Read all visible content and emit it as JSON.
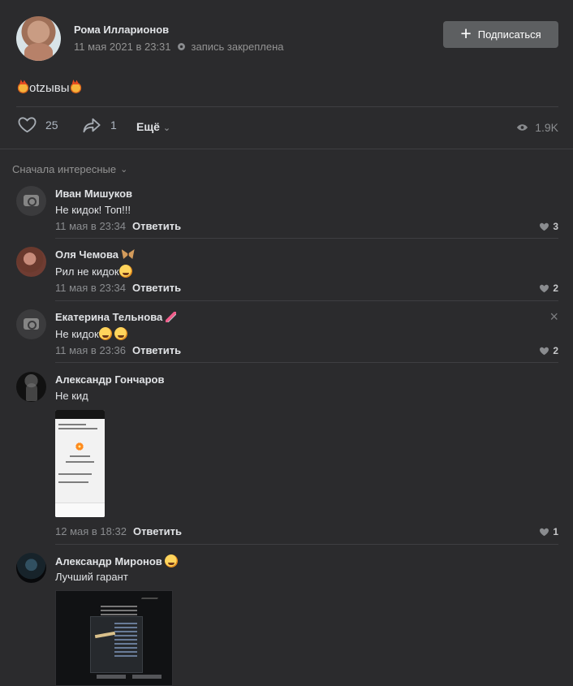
{
  "post": {
    "author": "Рома Илларионов",
    "date": "11 мая 2021 в 23:31",
    "pinned": "запись закреплена",
    "subscribe_label": "Подписаться",
    "text": "otzывы",
    "likes": "25",
    "shares": "1",
    "more": "Ещё",
    "views": "1.9K"
  },
  "comments_sort": "Сначала интересные",
  "comments": [
    {
      "name": "Иван Мишуков",
      "text": "Не кидок! Топ!!!",
      "date": "11 мая в 23:34",
      "reply": "Ответить",
      "likes": "3"
    },
    {
      "name": "Оля Чемова",
      "text": "Рил не кидок",
      "date": "11 мая в 23:34",
      "reply": "Ответить",
      "likes": "2"
    },
    {
      "name": "Екатерина Тельнова",
      "text": "Не кидок",
      "date": "11 мая в 23:36",
      "reply": "Ответить",
      "likes": "2"
    },
    {
      "name": "Александр Гончаров",
      "text": "Не кид",
      "date": "12 мая в 18:32",
      "reply": "Ответить",
      "likes": "1"
    },
    {
      "name": "Александр Миронов",
      "text": "Лучший гарант"
    }
  ],
  "icons": {
    "like": "heart-icon",
    "share": "share-icon",
    "views": "eye-icon",
    "close": "close-icon",
    "photo": "camera-icon"
  }
}
